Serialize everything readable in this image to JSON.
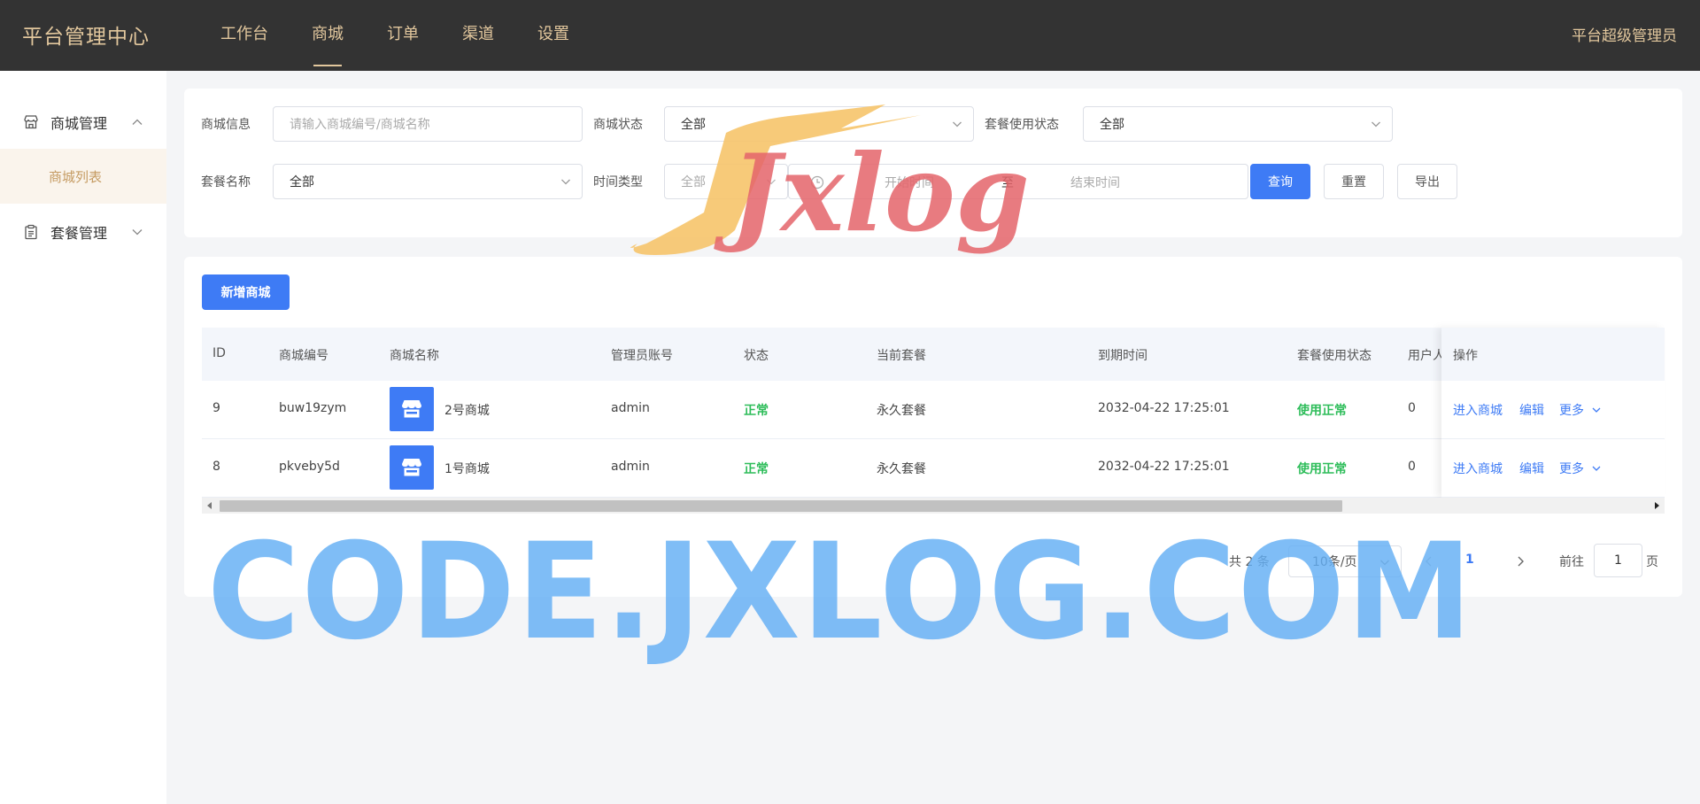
{
  "header": {
    "brand": "平台管理中心",
    "nav": [
      "工作台",
      "商城",
      "订单",
      "渠道",
      "设置"
    ],
    "active_nav": "商城",
    "user": "平台超级管理员"
  },
  "sidebar": {
    "groups": [
      {
        "label": "商城管理",
        "icon": "store-icon",
        "expanded": true
      },
      {
        "label": "套餐管理",
        "icon": "clipboard-icon",
        "expanded": false
      }
    ],
    "active_item": "商城列表"
  },
  "filters": {
    "shop_info_label": "商城信息",
    "shop_info_placeholder": "请输入商城编号/商城名称",
    "shop_status_label": "商城状态",
    "shop_status_value": "全部",
    "package_status_label": "套餐使用状态",
    "package_status_value": "全部",
    "package_name_label": "套餐名称",
    "package_name_value": "全部",
    "time_type_label": "时间类型",
    "time_type_value": "全部",
    "start_placeholder": "开始时间",
    "range_sep": "至",
    "end_placeholder": "结束时间",
    "search_btn": "查询",
    "reset_btn": "重置",
    "export_btn": "导出"
  },
  "table": {
    "add_btn": "新增商城",
    "columns": [
      "ID",
      "商城编号",
      "商城名称",
      "管理员账号",
      "状态",
      "当前套餐",
      "到期时间",
      "套餐使用状态",
      "用户人",
      "操作"
    ],
    "rows": [
      {
        "id": "9",
        "code": "buw19zym",
        "name": "2号商城",
        "admin": "admin",
        "status": "正常",
        "package": "永久套餐",
        "expire": "2032-04-22 17:25:01",
        "usage": "使用正常",
        "users": "0"
      },
      {
        "id": "8",
        "code": "pkveby5d",
        "name": "1号商城",
        "admin": "admin",
        "status": "正常",
        "package": "永久套餐",
        "expire": "2032-04-22 17:25:01",
        "usage": "使用正常",
        "users": "0"
      }
    ],
    "ops": {
      "enter": "进入商城",
      "edit": "编辑",
      "more": "更多"
    }
  },
  "pagination": {
    "total": "共 2 条",
    "page_size": "10条/页",
    "current": "1",
    "goto_prefix": "前往",
    "goto_value": "1",
    "goto_suffix": "页"
  },
  "watermarks": {
    "big": "CODE.JXLOG.COM",
    "logo": "Jxlog"
  },
  "colors": {
    "header_bg": "#333333",
    "accent_gold": "#e2c79d",
    "primary": "#3e7bf5",
    "success": "#2ebd5a"
  }
}
